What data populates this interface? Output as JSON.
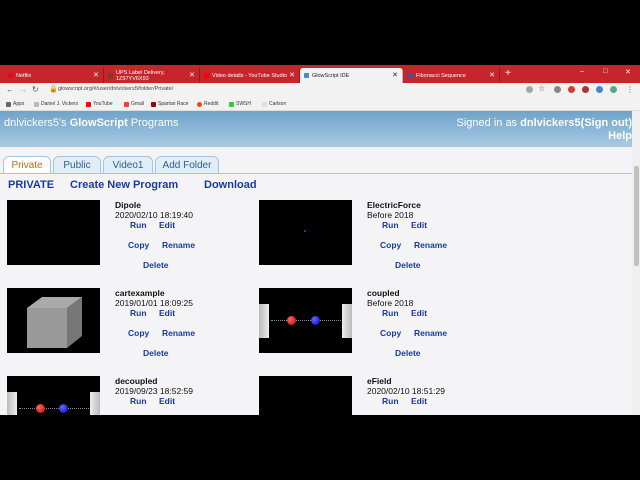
{
  "browser": {
    "tabs": [
      {
        "label": "Netflix",
        "color": "#e50914"
      },
      {
        "label": "UPS Label Delivery, 1Z97YV6X93",
        "color": "#6b4423"
      },
      {
        "label": "Video details - YouTube Studio",
        "color": "#ff0000"
      },
      {
        "label": "GlowScript IDE",
        "color": "#4a8ac4"
      },
      {
        "label": "Fibonacci Sequence",
        "color": "#3b5998"
      }
    ],
    "new_tab": "+",
    "url": "glowscript.org/#/user/dnlvickers5/folder/Private/",
    "bookmarks": [
      "Apps",
      "Daniel J. Vickers",
      "YouTube",
      "Gmail",
      "Spartan Race",
      "Reddit",
      "SWSH",
      "Carlson"
    ],
    "controls": {
      "minimize": "–",
      "maximize": "□",
      "close": "✕"
    }
  },
  "header": {
    "user_prefix": "dnlvickers5's ",
    "brand": "GlowScript",
    "suffix": " Programs",
    "signed_in_label": "Signed in as ",
    "username": "dnlvickers5",
    "signout": "(Sign out)",
    "help": "Help"
  },
  "tabs": [
    "Private",
    "Public",
    "Video1",
    "Add Folder"
  ],
  "actions": [
    "PRIVATE",
    "Create New Program",
    "Download"
  ],
  "programs": [
    {
      "name": "Dipole",
      "date": "2020/02/10 18:19:40"
    },
    {
      "name": "ElectricForce",
      "date": "Before 2018"
    },
    {
      "name": "cartexample",
      "date": "2019/01/01 18:09:25"
    },
    {
      "name": "coupled",
      "date": "Before 2018"
    },
    {
      "name": "decoupled",
      "date": "2019/09/23 18:52:59"
    },
    {
      "name": "eField",
      "date": "2020/02/10 18:51:29"
    }
  ],
  "program_actions": {
    "run": "Run",
    "edit": "Edit",
    "copy": "Copy",
    "rename": "Rename",
    "delete": "Delete"
  }
}
